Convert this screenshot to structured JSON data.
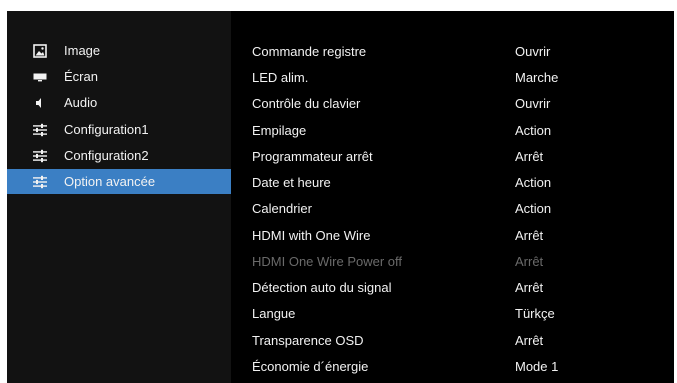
{
  "menu": {
    "items": [
      {
        "label": "Image",
        "icon": "image-icon"
      },
      {
        "label": "Écran",
        "icon": "screen-icon"
      },
      {
        "label": "Audio",
        "icon": "speaker-icon"
      },
      {
        "label": "Configuration1",
        "icon": "settings-sliders-icon"
      },
      {
        "label": "Configuration2",
        "icon": "settings-sliders-icon"
      },
      {
        "label": "Option avancée",
        "icon": "settings-sliders-icon",
        "selected": true
      }
    ]
  },
  "options": {
    "rows": [
      {
        "name": "Commande registre",
        "value": "Ouvrir"
      },
      {
        "name": "LED alim.",
        "value": "Marche"
      },
      {
        "name": "Contrôle du clavier",
        "value": "Ouvrir"
      },
      {
        "name": "Empilage",
        "value": "Action"
      },
      {
        "name": "Programmateur arrêt",
        "value": "Arrêt"
      },
      {
        "name": "Date et heure",
        "value": "Action"
      },
      {
        "name": "Calendrier",
        "value": "Action"
      },
      {
        "name": "HDMI with One Wire",
        "value": "Arrêt"
      },
      {
        "name": "HDMI One Wire Power off",
        "value": "Arrêt",
        "disabled": true
      },
      {
        "name": "Détection auto du signal",
        "value": "Arrêt"
      },
      {
        "name": "Langue",
        "value": "Türkçe"
      },
      {
        "name": "Transparence OSD",
        "value": "Arrêt"
      },
      {
        "name": "Économie d´énergie",
        "value": "Mode 1"
      }
    ]
  },
  "colors": {
    "background": "#000000",
    "left_pane": "#121212",
    "selection": "#3b7fc4",
    "text": "#f2f2f2",
    "disabled_text": "#6a6a6a"
  }
}
